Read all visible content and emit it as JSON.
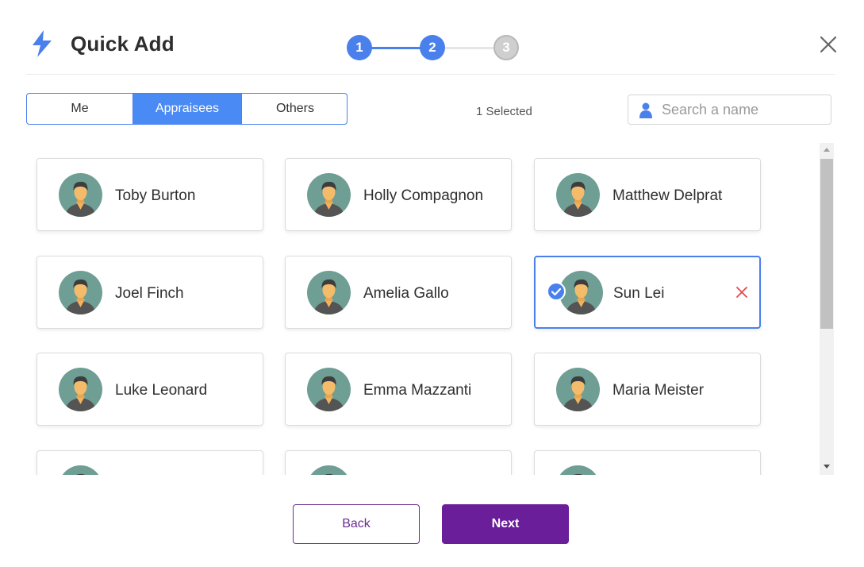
{
  "header": {
    "title": "Quick Add",
    "accent_color": "#4a80ec",
    "icon": "lightning-bolt-icon",
    "close_icon": "close-icon"
  },
  "stepper": {
    "steps": [
      {
        "label": "1",
        "state": "complete"
      },
      {
        "label": "2",
        "state": "current"
      },
      {
        "label": "3",
        "state": "upcoming"
      }
    ]
  },
  "tabs": [
    {
      "label": "Me",
      "active": false
    },
    {
      "label": "Appraisees",
      "active": true
    },
    {
      "label": "Others",
      "active": false
    }
  ],
  "selection": {
    "count_label": "1 Selected"
  },
  "search": {
    "placeholder": "Search a name",
    "value": "",
    "icon": "person-icon"
  },
  "people": [
    {
      "name": "Toby Burton",
      "selected": false
    },
    {
      "name": "Holly Compagnon",
      "selected": false
    },
    {
      "name": "Matthew Delprat",
      "selected": false
    },
    {
      "name": "Joel Finch",
      "selected": false
    },
    {
      "name": "Amelia Gallo",
      "selected": false
    },
    {
      "name": "Sun Lei",
      "selected": true
    },
    {
      "name": "Luke Leonard",
      "selected": false
    },
    {
      "name": "Emma Mazzanti",
      "selected": false
    },
    {
      "name": "Maria Meister",
      "selected": false
    },
    {
      "name": "",
      "selected": false
    },
    {
      "name": "",
      "selected": false
    },
    {
      "name": "",
      "selected": false
    }
  ],
  "footer": {
    "back_label": "Back",
    "next_label": "Next",
    "next_color": "#6a1e9a"
  }
}
